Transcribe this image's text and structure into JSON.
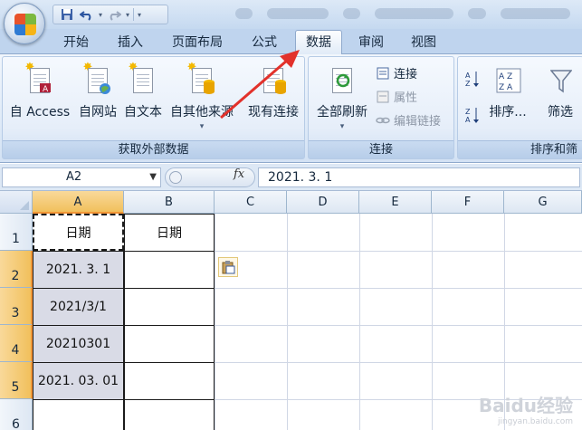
{
  "quick_access": {
    "icons": [
      "save-icon",
      "undo-icon",
      "redo-icon",
      "customize-qat-icon"
    ]
  },
  "tabs": [
    "开始",
    "插入",
    "页面布局",
    "公式",
    "数据",
    "审阅",
    "视图"
  ],
  "active_tab": "数据",
  "ribbon": {
    "get_external": {
      "label": "获取外部数据",
      "buttons": [
        "自 Access",
        "自网站",
        "自文本",
        "自其他来源",
        "现有连接"
      ]
    },
    "connections": {
      "label": "连接",
      "refresh_all": "全部刷新",
      "connections": "连接",
      "properties": "属性",
      "edit_links": "编辑链接"
    },
    "sort_filter": {
      "label": "排序和筛",
      "sort": "排序...",
      "filter": "筛选"
    }
  },
  "formula_bar": {
    "name_box": "A2",
    "fx_label": "fx",
    "value": "2021. 3. 1"
  },
  "sheet": {
    "columns": [
      "A",
      "B",
      "C",
      "D",
      "E",
      "F",
      "G"
    ],
    "rows": [
      "1",
      "2",
      "3",
      "4",
      "5",
      "6"
    ],
    "selected_column": "A",
    "cells": {
      "A1": "日期",
      "B1": "日期",
      "A2": "2021. 3. 1",
      "A3": "2021/3/1",
      "A4": "20210301",
      "A5": "2021. 03. 01"
    }
  },
  "colors": {
    "accent_selected": "#f1c05c",
    "annotation_arrow": "#e2312b",
    "ribbon_bg": "#e0ebf8"
  },
  "watermark": {
    "text": "Baidu经验",
    "sub": "jingyan.baidu.com"
  }
}
